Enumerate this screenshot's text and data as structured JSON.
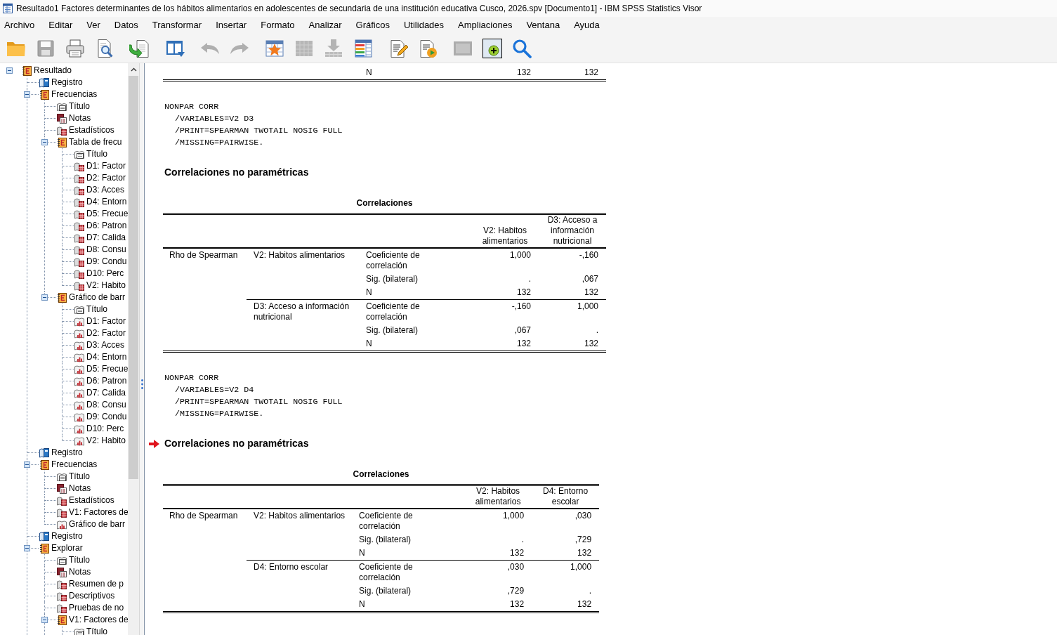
{
  "window": {
    "title": "Resultado1 Factores determinantes de los hábitos alimentarios en adolescentes de secundaria de una institución educativa Cusco, 2026.spv [Documento1] - IBM SPSS Statistics Visor"
  },
  "menu": [
    "Archivo",
    "Editar",
    "Ver",
    "Datos",
    "Transformar",
    "Insertar",
    "Formato",
    "Analizar",
    "Gráficos",
    "Utilidades",
    "Ampliaciones",
    "Ventana",
    "Ayuda"
  ],
  "toolbar": {
    "groups": [
      [
        {
          "kind": "open",
          "disabled": false
        },
        {
          "kind": "save",
          "disabled": true
        },
        {
          "kind": "print",
          "disabled": false
        },
        {
          "kind": "preview",
          "disabled": false
        }
      ],
      [
        {
          "kind": "export",
          "disabled": false
        }
      ],
      [
        {
          "kind": "window",
          "disabled": false
        }
      ],
      [
        {
          "kind": "undo",
          "disabled": true
        },
        {
          "kind": "redo",
          "disabled": true
        }
      ],
      [
        {
          "kind": "goto",
          "disabled": false
        },
        {
          "kind": "grid",
          "disabled": true
        },
        {
          "kind": "insert",
          "disabled": true
        },
        {
          "kind": "variables",
          "disabled": false
        }
      ],
      [
        {
          "kind": "edit",
          "disabled": false
        },
        {
          "kind": "run",
          "disabled": false
        }
      ],
      [
        {
          "kind": "frame",
          "disabled": true
        },
        {
          "kind": "designate",
          "disabled": false
        },
        {
          "kind": "search",
          "disabled": false
        }
      ]
    ]
  },
  "tree": [
    {
      "label": "Resultado",
      "kind": "heading",
      "expanded": true,
      "children": [
        {
          "label": "Registro",
          "kind": "log"
        },
        {
          "label": "Frecuencias",
          "kind": "heading",
          "expanded": true,
          "children": [
            {
              "label": "Título",
              "kind": "title"
            },
            {
              "label": "Notas",
              "kind": "notes"
            },
            {
              "label": "Estadísticos",
              "kind": "table"
            },
            {
              "label": "Tabla de frecu",
              "kind": "heading",
              "expanded": true,
              "children": [
                {
                  "label": "Título",
                  "kind": "title"
                },
                {
                  "label": "D1: Factor",
                  "kind": "table"
                },
                {
                  "label": "D2: Factor",
                  "kind": "table"
                },
                {
                  "label": "D3: Acces",
                  "kind": "table"
                },
                {
                  "label": "D4: Entorn",
                  "kind": "table"
                },
                {
                  "label": "D5: Frecue",
                  "kind": "table"
                },
                {
                  "label": "D6: Patron",
                  "kind": "table"
                },
                {
                  "label": "D7: Calida",
                  "kind": "table"
                },
                {
                  "label": "D8: Consu",
                  "kind": "table"
                },
                {
                  "label": "D9: Condu",
                  "kind": "table"
                },
                {
                  "label": "D10: Perc",
                  "kind": "table"
                },
                {
                  "label": "V2: Habito",
                  "kind": "table"
                }
              ]
            },
            {
              "label": "Gráfico de barr",
              "kind": "heading",
              "expanded": true,
              "children": [
                {
                  "label": "Título",
                  "kind": "title"
                },
                {
                  "label": "D1: Factor",
                  "kind": "chart"
                },
                {
                  "label": "D2: Factor",
                  "kind": "chart"
                },
                {
                  "label": "D3: Acces",
                  "kind": "chart"
                },
                {
                  "label": "D4: Entorn",
                  "kind": "chart"
                },
                {
                  "label": "D5: Frecue",
                  "kind": "chart"
                },
                {
                  "label": "D6: Patron",
                  "kind": "chart"
                },
                {
                  "label": "D7: Calida",
                  "kind": "chart"
                },
                {
                  "label": "D8: Consu",
                  "kind": "chart"
                },
                {
                  "label": "D9: Condu",
                  "kind": "chart"
                },
                {
                  "label": "D10: Perc",
                  "kind": "chart"
                },
                {
                  "label": "V2: Habito",
                  "kind": "chart"
                }
              ]
            }
          ]
        },
        {
          "label": "Registro",
          "kind": "log"
        },
        {
          "label": "Frecuencias",
          "kind": "heading",
          "expanded": true,
          "children": [
            {
              "label": "Título",
              "kind": "title"
            },
            {
              "label": "Notas",
              "kind": "notes"
            },
            {
              "label": "Estadísticos",
              "kind": "table"
            },
            {
              "label": "V1: Factores de",
              "kind": "table"
            },
            {
              "label": "Gráfico de barr",
              "kind": "chart"
            }
          ]
        },
        {
          "label": "Registro",
          "kind": "log"
        },
        {
          "label": "Explorar",
          "kind": "heading",
          "expanded": true,
          "children": [
            {
              "label": "Título",
              "kind": "title"
            },
            {
              "label": "Notas",
              "kind": "notes"
            },
            {
              "label": "Resumen de p",
              "kind": "table"
            },
            {
              "label": "Descriptivos",
              "kind": "table"
            },
            {
              "label": "Pruebas de no",
              "kind": "table"
            },
            {
              "label": "V1: Factores de",
              "kind": "heading",
              "expanded": true,
              "children": [
                {
                  "label": "Título",
                  "kind": "title"
                }
              ]
            }
          ]
        }
      ]
    }
  ],
  "output": [
    {
      "kind": "table_end",
      "rows": [
        {
          "statistic": "N",
          "values": [
            "132",
            "132"
          ]
        }
      ]
    },
    {
      "kind": "syntax",
      "lines": [
        "NONPAR CORR",
        "/VARIABLES=V2 D3",
        "/PRINT=SPEARMAN TWOTAIL NOSIG FULL",
        "/MISSING=PAIRWISE."
      ]
    },
    {
      "kind": "heading",
      "text": "Correlaciones no paramétricas",
      "current": false
    },
    {
      "kind": "table",
      "title": "Correlaciones",
      "columns": [
        "V2: Habitos alimentarios",
        "D3: Acceso a información nutricional"
      ],
      "row_header": "Rho de Spearman",
      "groups": [
        {
          "variable": "V2: Habitos alimentarios",
          "rows": [
            {
              "statistic": "Coeficiente de correlación",
              "values": [
                "1,000",
                "-,160"
              ]
            },
            {
              "statistic": "Sig. (bilateral)",
              "values": [
                ".",
                ",067"
              ]
            },
            {
              "statistic": "N",
              "values": [
                "132",
                "132"
              ]
            }
          ]
        },
        {
          "variable": "D3: Acceso a información nutricional",
          "rows": [
            {
              "statistic": "Coeficiente de correlación",
              "values": [
                "-,160",
                "1,000"
              ]
            },
            {
              "statistic": "Sig. (bilateral)",
              "values": [
                ",067",
                "."
              ]
            },
            {
              "statistic": "N",
              "values": [
                "132",
                "132"
              ]
            }
          ]
        }
      ]
    },
    {
      "kind": "syntax",
      "lines": [
        "NONPAR CORR",
        "/VARIABLES=V2 D4",
        "/PRINT=SPEARMAN TWOTAIL NOSIG FULL",
        "/MISSING=PAIRWISE."
      ]
    },
    {
      "kind": "heading",
      "text": "Correlaciones no paramétricas",
      "current": true
    },
    {
      "kind": "table",
      "title": "Correlaciones",
      "columns": [
        "V2: Habitos alimentarios",
        "D4: Entorno escolar"
      ],
      "row_header": "Rho de Spearman",
      "groups": [
        {
          "variable": "V2: Habitos alimentarios",
          "rows": [
            {
              "statistic": "Coeficiente de correlación",
              "values": [
                "1,000",
                ",030"
              ]
            },
            {
              "statistic": "Sig. (bilateral)",
              "values": [
                ".",
                ",729"
              ]
            },
            {
              "statistic": "N",
              "values": [
                "132",
                "132"
              ]
            }
          ]
        },
        {
          "variable": "D4: Entorno escolar",
          "rows": [
            {
              "statistic": "Coeficiente de correlación",
              "values": [
                ",030",
                "1,000"
              ]
            },
            {
              "statistic": "Sig. (bilateral)",
              "values": [
                ",729",
                "."
              ]
            },
            {
              "statistic": "N",
              "values": [
                "132",
                "132"
              ]
            }
          ]
        }
      ]
    }
  ]
}
